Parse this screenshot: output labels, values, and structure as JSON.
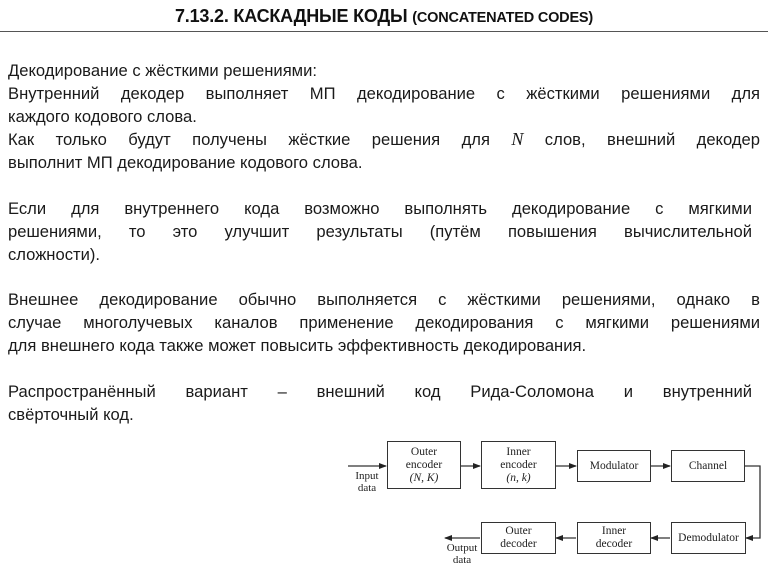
{
  "title": {
    "main": "7.13.2. КАСКАДНЫЕ КОДЫ",
    "sub": "(CONCATENATED CODES)"
  },
  "paragraphs": {
    "p1": {
      "lines": [
        "Декодирование с жёсткими решениями:",
        "Внутренний декодер выполняет МП декодирование с жёсткими решениями для",
        "каждого кодового слова."
      ],
      "line4_before": "Как только будут получены жёсткие решения для ",
      "line4_var": "N",
      "line4_after": " слов, внешний декодер",
      "line5": "выполнит МП декодирование кодового слова."
    },
    "p2": {
      "lines": [
        "Если для внутреннего кода возможно выполнять декодирование с мягкими",
        "решениями, то это улучшит результаты (путём повышения вычислительной",
        "сложности)."
      ]
    },
    "p3": {
      "lines": [
        "Внешнее декодирование обычно выполняется с жёсткими решениями, однако в",
        "случае многолучевых каналов применение декодирования с мягкими решениями",
        "для внешнего кода также может повысить эффективность декодирования."
      ]
    },
    "p4": {
      "lines": [
        "Распространённый вариант – внешний код Рида-Соломона и внутренний",
        "свёрточный код."
      ]
    }
  },
  "diagram": {
    "input_label": [
      "Input",
      "data"
    ],
    "output_label": [
      "Output",
      "data"
    ],
    "blocks": {
      "outer_encoder": {
        "line1": "Outer",
        "line2": "encoder",
        "params": "(N, K)"
      },
      "inner_encoder": {
        "line1": "Inner",
        "line2": "encoder",
        "params": "(n, k)"
      },
      "modulator": {
        "label": "Modulator"
      },
      "channel": {
        "label": "Channel"
      },
      "demodulator": {
        "label": "Demodulator"
      },
      "inner_decoder": {
        "line1": "Inner",
        "line2": "decoder"
      },
      "outer_decoder": {
        "line1": "Outer",
        "line2": "decoder"
      }
    }
  }
}
